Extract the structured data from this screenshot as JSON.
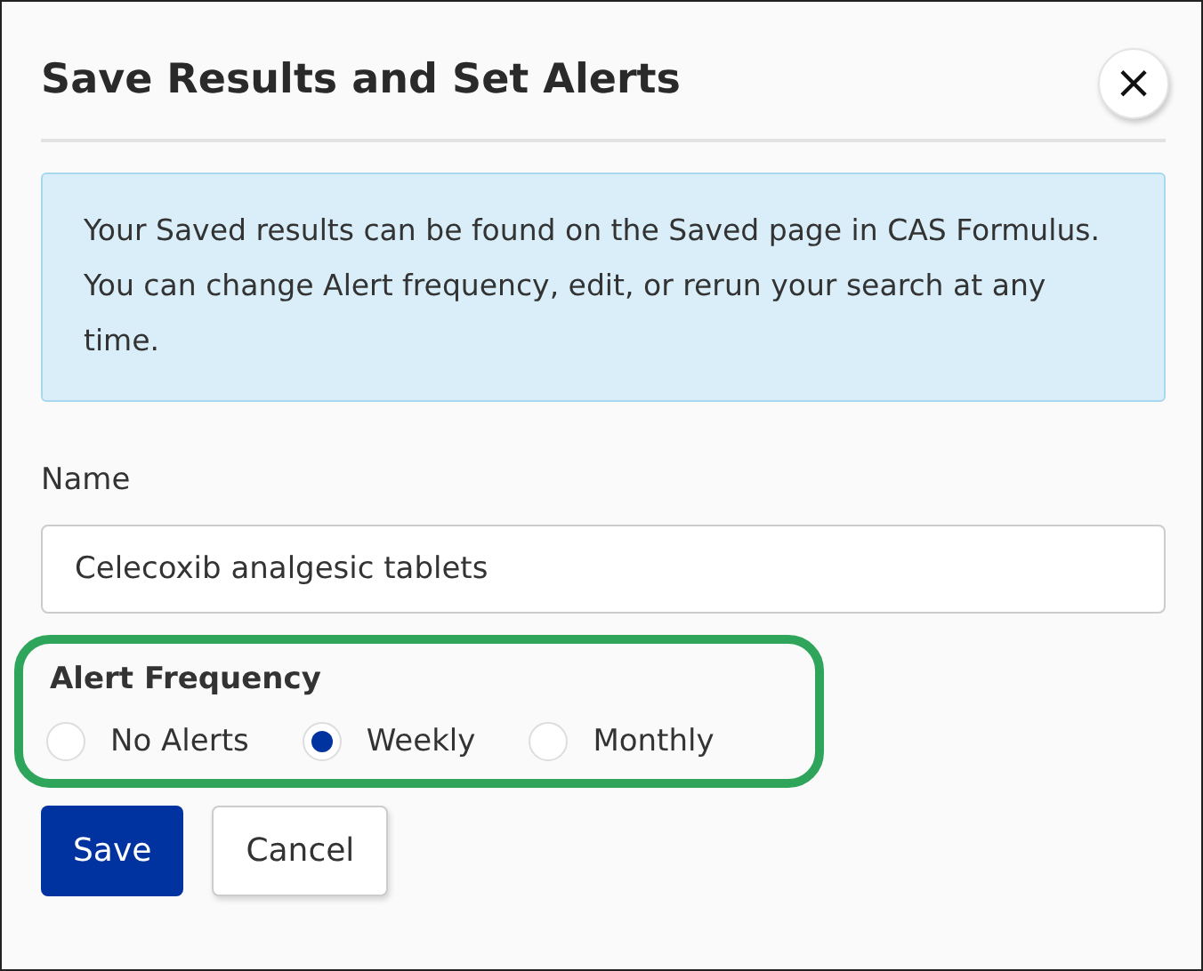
{
  "dialog": {
    "title": "Save Results and Set Alerts",
    "close_label": "×"
  },
  "notice": "Your Saved results can be found on the Saved page in CAS Formulus. You can change Alert frequency, edit, or rerun your search at any time.",
  "name_field": {
    "label": "Name",
    "value": "Celecoxib analgesic tablets"
  },
  "alert_frequency": {
    "label": "Alert Frequency",
    "highlighted": true,
    "options": [
      {
        "label": "No Alerts",
        "selected": false
      },
      {
        "label": "Weekly",
        "selected": true
      },
      {
        "label": "Monthly",
        "selected": false
      }
    ]
  },
  "buttons": [
    {
      "label": "Save",
      "kind": "primary"
    },
    {
      "label": "Cancel",
      "kind": "secondary"
    }
  ]
}
